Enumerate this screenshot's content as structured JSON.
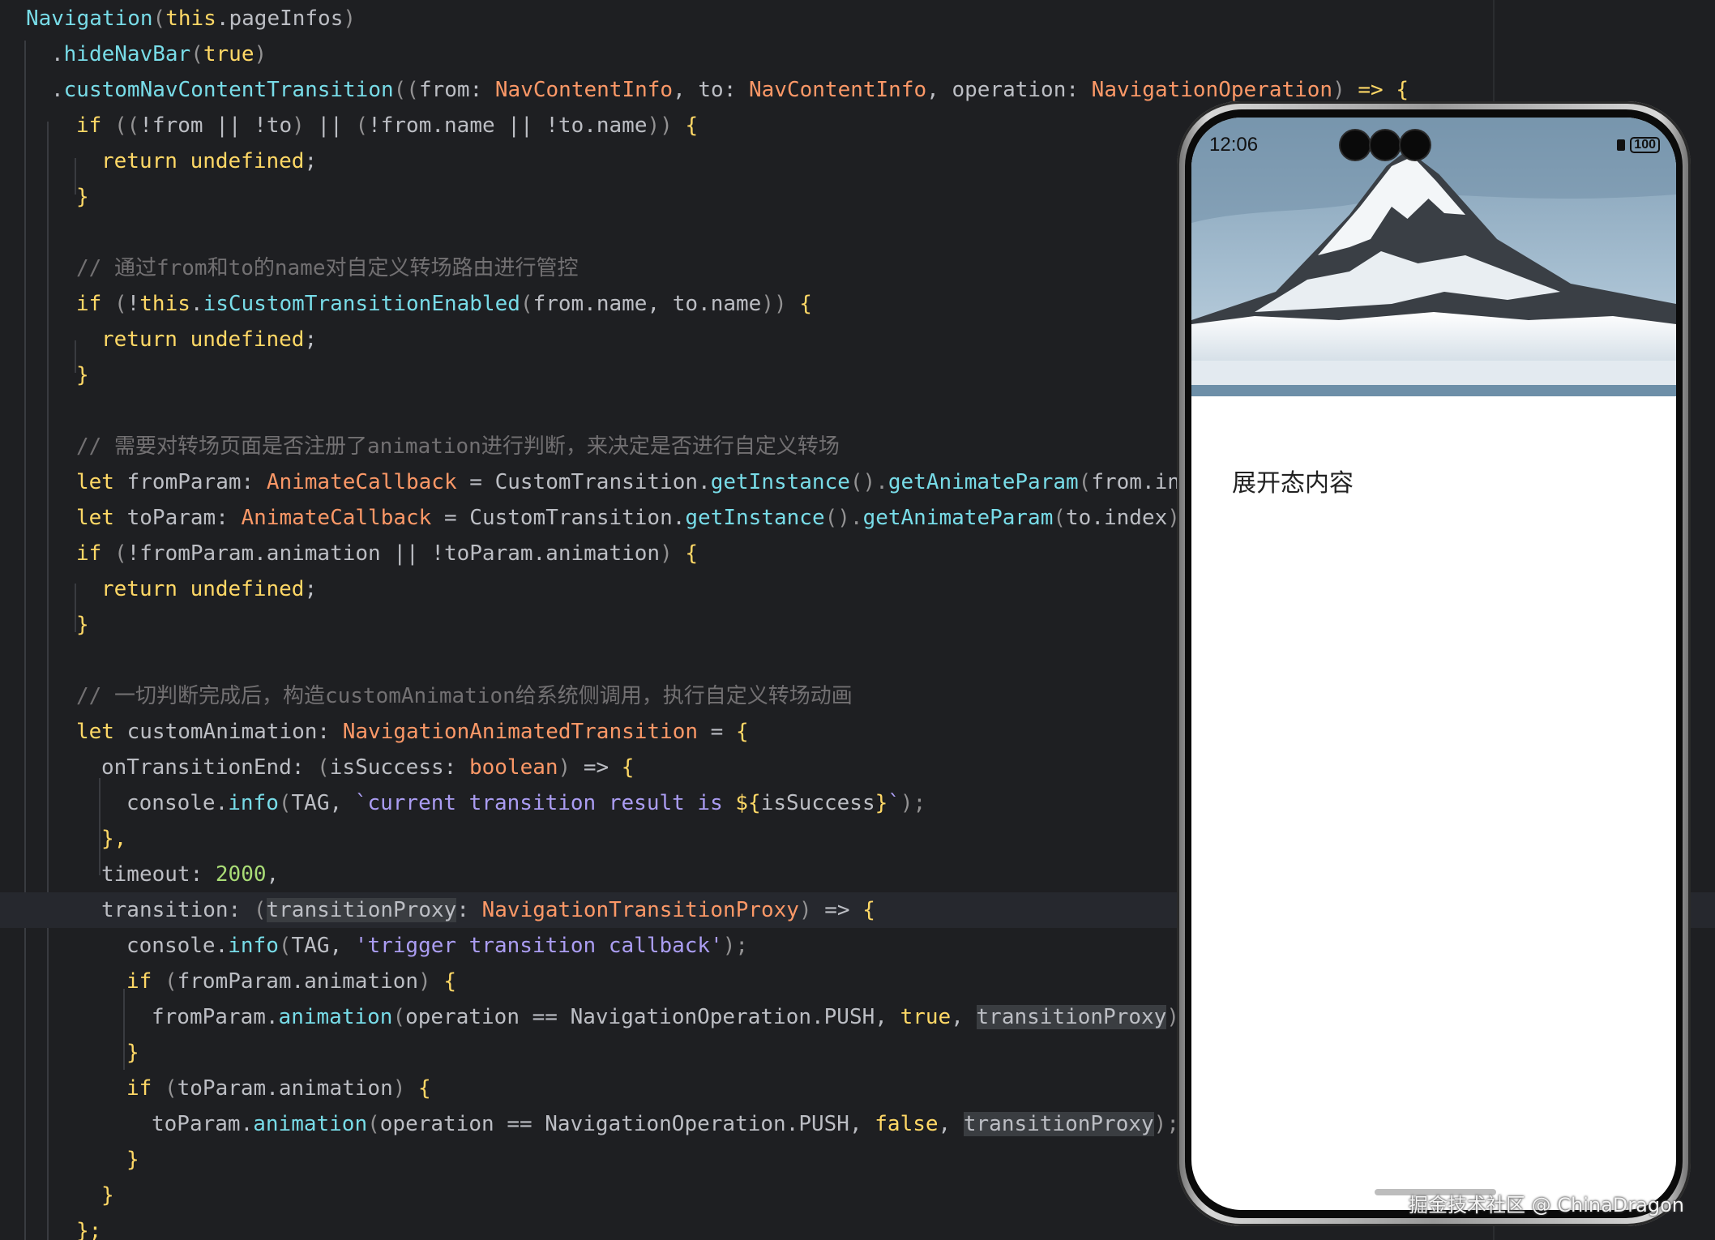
{
  "colors": {
    "editor_bg": "#1e1f22",
    "text": "#bcbec4",
    "keyword": "#ffd866",
    "type": "#fc9867",
    "method": "#78dce8",
    "string": "#ab9df2",
    "comment": "#727072",
    "number": "#a9dc76",
    "punct": "#939293"
  },
  "code_lines": [
    {
      "indent": 0,
      "tokens": [
        {
          "t": "Navigation",
          "c": "method"
        },
        {
          "t": "(",
          "c": "punct"
        },
        {
          "t": "this",
          "c": "keyword"
        },
        {
          "t": ".pageInfos",
          "c": "text"
        },
        {
          "t": ")",
          "c": "punct"
        }
      ]
    },
    {
      "indent": 1,
      "tokens": [
        {
          "t": ".",
          "c": "text"
        },
        {
          "t": "hideNavBar",
          "c": "method"
        },
        {
          "t": "(",
          "c": "punct"
        },
        {
          "t": "true",
          "c": "keyword"
        },
        {
          "t": ")",
          "c": "punct"
        }
      ]
    },
    {
      "indent": 1,
      "tokens": [
        {
          "t": ".",
          "c": "text"
        },
        {
          "t": "customNavContentTransition",
          "c": "method"
        },
        {
          "t": "((",
          "c": "punct"
        },
        {
          "t": "from",
          "c": "text"
        },
        {
          "t": ": ",
          "c": "text"
        },
        {
          "t": "NavContentInfo",
          "c": "type"
        },
        {
          "t": ", ",
          "c": "text"
        },
        {
          "t": "to",
          "c": "text"
        },
        {
          "t": ": ",
          "c": "text"
        },
        {
          "t": "NavContentInfo",
          "c": "type"
        },
        {
          "t": ", ",
          "c": "text"
        },
        {
          "t": "operation",
          "c": "text"
        },
        {
          "t": ": ",
          "c": "text"
        },
        {
          "t": "NavigationOperation",
          "c": "type"
        },
        {
          "t": ") ",
          "c": "punct"
        },
        {
          "t": "=>",
          "c": "keyword"
        },
        {
          "t": " {",
          "c": "keyword"
        }
      ]
    },
    {
      "indent": 2,
      "tokens": [
        {
          "t": "if",
          "c": "keyword"
        },
        {
          "t": " ((",
          "c": "punct"
        },
        {
          "t": "!from",
          "c": "text"
        },
        {
          "t": " || ",
          "c": "text"
        },
        {
          "t": "!to",
          "c": "text"
        },
        {
          "t": ")",
          "c": "punct"
        },
        {
          "t": " || ",
          "c": "text"
        },
        {
          "t": "(",
          "c": "punct"
        },
        {
          "t": "!from.name",
          "c": "text"
        },
        {
          "t": " || ",
          "c": "text"
        },
        {
          "t": "!to.name",
          "c": "text"
        },
        {
          "t": "))",
          "c": "punct"
        },
        {
          "t": " {",
          "c": "keyword"
        }
      ]
    },
    {
      "indent": 3,
      "tokens": [
        {
          "t": "return undefined",
          "c": "keyword"
        },
        {
          "t": ";",
          "c": "text"
        }
      ]
    },
    {
      "indent": 2,
      "tokens": [
        {
          "t": "}",
          "c": "keyword"
        }
      ]
    },
    {
      "indent": 0,
      "tokens": []
    },
    {
      "indent": 2,
      "tokens": [
        {
          "t": "// 通过from和to的name对自定义转场路由进行管控",
          "c": "comment"
        }
      ]
    },
    {
      "indent": 2,
      "tokens": [
        {
          "t": "if",
          "c": "keyword"
        },
        {
          "t": " (",
          "c": "punct"
        },
        {
          "t": "!",
          "c": "text"
        },
        {
          "t": "this",
          "c": "keyword"
        },
        {
          "t": ".",
          "c": "text"
        },
        {
          "t": "isCustomTransitionEnabled",
          "c": "method"
        },
        {
          "t": "(",
          "c": "punct"
        },
        {
          "t": "from.name, to.name",
          "c": "text"
        },
        {
          "t": "))",
          "c": "punct"
        },
        {
          "t": " {",
          "c": "keyword"
        }
      ]
    },
    {
      "indent": 3,
      "tokens": [
        {
          "t": "return undefined",
          "c": "keyword"
        },
        {
          "t": ";",
          "c": "text"
        }
      ]
    },
    {
      "indent": 2,
      "tokens": [
        {
          "t": "}",
          "c": "keyword"
        }
      ]
    },
    {
      "indent": 0,
      "tokens": []
    },
    {
      "indent": 2,
      "tokens": [
        {
          "t": "// 需要对转场页面是否注册了animation进行判断，来决定是否进行自定义转场",
          "c": "comment"
        }
      ]
    },
    {
      "indent": 2,
      "tokens": [
        {
          "t": "let",
          "c": "keyword"
        },
        {
          "t": " fromParam: ",
          "c": "text"
        },
        {
          "t": "AnimateCallback",
          "c": "type"
        },
        {
          "t": " = CustomTransition.",
          "c": "text"
        },
        {
          "t": "getInstance",
          "c": "method"
        },
        {
          "t": "().",
          "c": "punct"
        },
        {
          "t": "getAnimateParam",
          "c": "method"
        },
        {
          "t": "(",
          "c": "punct"
        },
        {
          "t": "from.index",
          "c": "text"
        },
        {
          "t": ");",
          "c": "punct"
        }
      ]
    },
    {
      "indent": 2,
      "tokens": [
        {
          "t": "let",
          "c": "keyword"
        },
        {
          "t": " toParam: ",
          "c": "text"
        },
        {
          "t": "AnimateCallback",
          "c": "type"
        },
        {
          "t": " = CustomTransition.",
          "c": "text"
        },
        {
          "t": "getInstance",
          "c": "method"
        },
        {
          "t": "().",
          "c": "punct"
        },
        {
          "t": "getAnimateParam",
          "c": "method"
        },
        {
          "t": "(",
          "c": "punct"
        },
        {
          "t": "to.index",
          "c": "text"
        },
        {
          "t": ");",
          "c": "punct"
        }
      ]
    },
    {
      "indent": 2,
      "tokens": [
        {
          "t": "if",
          "c": "keyword"
        },
        {
          "t": " (",
          "c": "punct"
        },
        {
          "t": "!fromParam.animation || !toParam.animation",
          "c": "text"
        },
        {
          "t": ")",
          "c": "punct"
        },
        {
          "t": " {",
          "c": "keyword"
        }
      ]
    },
    {
      "indent": 3,
      "tokens": [
        {
          "t": "return undefined",
          "c": "keyword"
        },
        {
          "t": ";",
          "c": "text"
        }
      ]
    },
    {
      "indent": 2,
      "tokens": [
        {
          "t": "}",
          "c": "keyword"
        }
      ]
    },
    {
      "indent": 0,
      "tokens": []
    },
    {
      "indent": 2,
      "tokens": [
        {
          "t": "// 一切判断完成后，构造customAnimation给系统侧调用，执行自定义转场动画",
          "c": "comment"
        }
      ]
    },
    {
      "indent": 2,
      "tokens": [
        {
          "t": "let",
          "c": "keyword"
        },
        {
          "t": " customAnimation: ",
          "c": "text"
        },
        {
          "t": "NavigationAnimatedTransition",
          "c": "type"
        },
        {
          "t": " = ",
          "c": "text"
        },
        {
          "t": "{",
          "c": "keyword"
        }
      ]
    },
    {
      "indent": 3,
      "tokens": [
        {
          "t": "onTransitionEnd: ",
          "c": "text"
        },
        {
          "t": "(",
          "c": "punct"
        },
        {
          "t": "isSuccess: ",
          "c": "text"
        },
        {
          "t": "boolean",
          "c": "type"
        },
        {
          "t": ") ",
          "c": "punct"
        },
        {
          "t": "=>",
          "c": "text"
        },
        {
          "t": " {",
          "c": "keyword"
        }
      ]
    },
    {
      "indent": 4,
      "tokens": [
        {
          "t": "console.",
          "c": "text"
        },
        {
          "t": "info",
          "c": "method"
        },
        {
          "t": "(",
          "c": "punct"
        },
        {
          "t": "TAG, ",
          "c": "text"
        },
        {
          "t": "`current transition result is ",
          "c": "string"
        },
        {
          "t": "${",
          "c": "keyword"
        },
        {
          "t": "isSuccess",
          "c": "text"
        },
        {
          "t": "}",
          "c": "keyword"
        },
        {
          "t": "`",
          "c": "string"
        },
        {
          "t": ");",
          "c": "punct"
        }
      ]
    },
    {
      "indent": 3,
      "tokens": [
        {
          "t": "},",
          "c": "keyword"
        }
      ]
    },
    {
      "indent": 3,
      "tokens": [
        {
          "t": "timeout: ",
          "c": "text"
        },
        {
          "t": "2000",
          "c": "number"
        },
        {
          "t": ",",
          "c": "text"
        }
      ]
    },
    {
      "indent": 3,
      "current": true,
      "tokens": [
        {
          "t": "transition: ",
          "c": "text"
        },
        {
          "t": "(",
          "c": "punct"
        },
        {
          "t": "transitionProxy",
          "c": "text",
          "hl": true
        },
        {
          "t": ": ",
          "c": "text"
        },
        {
          "t": "NavigationTransitionProxy",
          "c": "type"
        },
        {
          "t": ") ",
          "c": "punct"
        },
        {
          "t": "=>",
          "c": "text"
        },
        {
          "t": " {",
          "c": "keyword"
        }
      ]
    },
    {
      "indent": 4,
      "tokens": [
        {
          "t": "console.",
          "c": "text"
        },
        {
          "t": "info",
          "c": "method"
        },
        {
          "t": "(",
          "c": "punct"
        },
        {
          "t": "TAG, ",
          "c": "text"
        },
        {
          "t": "'trigger transition callback'",
          "c": "string"
        },
        {
          "t": ");",
          "c": "punct"
        }
      ]
    },
    {
      "indent": 4,
      "tokens": [
        {
          "t": "if",
          "c": "keyword"
        },
        {
          "t": " (",
          "c": "punct"
        },
        {
          "t": "fromParam.animation",
          "c": "text"
        },
        {
          "t": ")",
          "c": "punct"
        },
        {
          "t": " {",
          "c": "keyword"
        }
      ]
    },
    {
      "indent": 5,
      "tokens": [
        {
          "t": "fromParam.",
          "c": "text"
        },
        {
          "t": "animation",
          "c": "method"
        },
        {
          "t": "(",
          "c": "punct"
        },
        {
          "t": "operation == NavigationOperation.PUSH, ",
          "c": "text"
        },
        {
          "t": "true",
          "c": "keyword"
        },
        {
          "t": ", ",
          "c": "text"
        },
        {
          "t": "transitionProxy",
          "c": "text",
          "hl": true
        },
        {
          "t": ");",
          "c": "punct"
        }
      ]
    },
    {
      "indent": 4,
      "tokens": [
        {
          "t": "}",
          "c": "keyword"
        }
      ]
    },
    {
      "indent": 4,
      "tokens": [
        {
          "t": "if",
          "c": "keyword"
        },
        {
          "t": " (",
          "c": "punct"
        },
        {
          "t": "toParam.animation",
          "c": "text"
        },
        {
          "t": ")",
          "c": "punct"
        },
        {
          "t": " {",
          "c": "keyword"
        }
      ]
    },
    {
      "indent": 5,
      "tokens": [
        {
          "t": "toParam.",
          "c": "text"
        },
        {
          "t": "animation",
          "c": "method"
        },
        {
          "t": "(",
          "c": "punct"
        },
        {
          "t": "operation == NavigationOperation.PUSH, ",
          "c": "text"
        },
        {
          "t": "false",
          "c": "keyword"
        },
        {
          "t": ", ",
          "c": "text"
        },
        {
          "t": "transitionProxy",
          "c": "text",
          "hl": true
        },
        {
          "t": ");",
          "c": "punct"
        }
      ]
    },
    {
      "indent": 4,
      "tokens": [
        {
          "t": "}",
          "c": "keyword"
        }
      ]
    },
    {
      "indent": 3,
      "tokens": [
        {
          "t": "}",
          "c": "keyword"
        }
      ]
    },
    {
      "indent": 2,
      "tokens": [
        {
          "t": "};",
          "c": "keyword"
        }
      ]
    }
  ],
  "phone": {
    "status_time": "12:06",
    "battery_level": "100",
    "content_text": "展开态内容",
    "hero_icon": "snowy-mountain-image"
  },
  "watermark": "掘金技术社区 @ ChinaDragon"
}
